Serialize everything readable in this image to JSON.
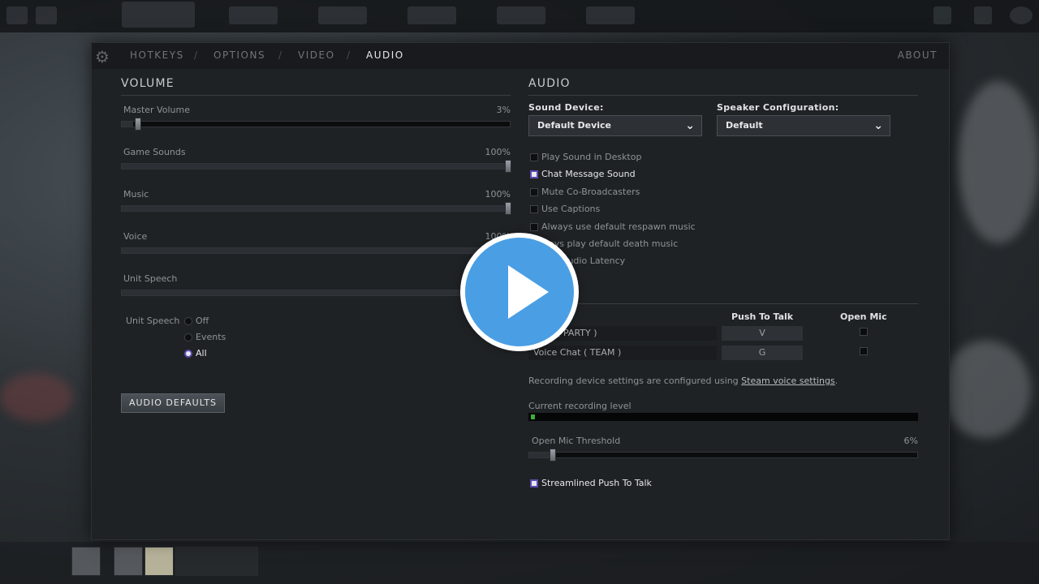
{
  "nav": {
    "tabs": [
      "HOTKEYS",
      "OPTIONS",
      "VIDEO",
      "AUDIO"
    ],
    "separator": "/",
    "active_tab": "AUDIO",
    "about": "ABOUT",
    "settings_icon": "gear-icon"
  },
  "volume": {
    "title": "VOLUME",
    "sliders": [
      {
        "label": "Master Volume",
        "value_text": "3%",
        "value": 0.03
      },
      {
        "label": "Game Sounds",
        "value_text": "100%",
        "value": 1.0
      },
      {
        "label": "Music",
        "value_text": "100%",
        "value": 1.0
      },
      {
        "label": "Voice",
        "value_text": "100%",
        "value": 1.0
      },
      {
        "label": "Unit Speech",
        "value_text": "",
        "value": 1.0
      }
    ],
    "unit_speech": {
      "label": "Unit Speech",
      "options": [
        "Off",
        "Events",
        "All"
      ],
      "selected": "All"
    },
    "defaults_button": "AUDIO DEFAULTS"
  },
  "audio": {
    "title": "AUDIO",
    "sound_device": {
      "label": "Sound Device:",
      "value": "Default Device"
    },
    "speaker_config": {
      "label": "Speaker Configuration:",
      "value": "Default"
    },
    "checkboxes": [
      {
        "label": "Play Sound in Desktop",
        "checked": false
      },
      {
        "label": "Chat Message Sound",
        "checked": true
      },
      {
        "label": "Mute Co-Broadcasters",
        "checked": false
      },
      {
        "label": "Use Captions",
        "checked": false
      },
      {
        "label": "Always use default respawn music",
        "checked": false
      },
      {
        "label": "ways play default death music",
        "checked": false
      },
      {
        "label": "tect Audio Latency",
        "checked": false
      }
    ]
  },
  "voice": {
    "col_push": "Push To Talk",
    "col_open": "Open Mic",
    "rows": [
      {
        "label": "Chat ( PARTY )",
        "key": "V"
      },
      {
        "label": "Voice Chat ( TEAM )",
        "key": "G"
      }
    ],
    "note_prefix": "Recording device settings are configured using ",
    "note_link": "Steam voice settings",
    "note_suffix": ".",
    "recording_label": "Current recording level",
    "recording_level": 0.01,
    "threshold_label": "Open Mic Threshold",
    "threshold_value_text": "6%",
    "threshold_value": 0.06,
    "streamlined_label": "Streamlined Push To Talk",
    "streamlined_checked": true
  },
  "overlay": {
    "icon": "play-icon"
  },
  "colors": {
    "accent": "#5c4bb0",
    "play": "#4a9ee4",
    "level": "#3fae3a"
  }
}
